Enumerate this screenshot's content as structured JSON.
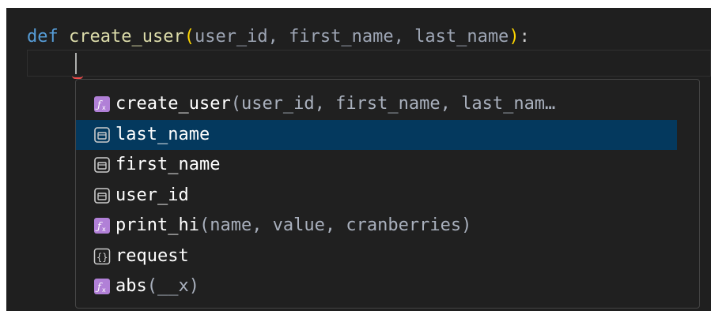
{
  "code": {
    "line1": {
      "keyword": "def",
      "function_name": "create_user",
      "open_paren": "(",
      "params": "user_id, first_name, last_name",
      "close_paren": ")",
      "colon": ":"
    }
  },
  "suggestions": [
    {
      "icon": "function-icon",
      "name": "create_user",
      "detail": "(user_id, first_name, last_nam…",
      "selected": false
    },
    {
      "icon": "variable-icon",
      "name": "last_name",
      "detail": "",
      "selected": true
    },
    {
      "icon": "variable-icon",
      "name": "first_name",
      "detail": "",
      "selected": false
    },
    {
      "icon": "variable-icon",
      "name": "user_id",
      "detail": "",
      "selected": false
    },
    {
      "icon": "function-icon",
      "name": "print_hi",
      "detail": "(name, value, cranberries)",
      "selected": false
    },
    {
      "icon": "module-icon",
      "name": "request",
      "detail": "",
      "selected": false
    },
    {
      "icon": "function-icon",
      "name": "abs",
      "detail": "(__x)",
      "selected": false
    }
  ],
  "colors": {
    "editor_bg": "#1f1f1f",
    "keyword": "#569cd6",
    "function": "#dcdcaa",
    "bracket": "#ffd700",
    "selection": "#04395e",
    "function_icon": "#b180d7"
  }
}
